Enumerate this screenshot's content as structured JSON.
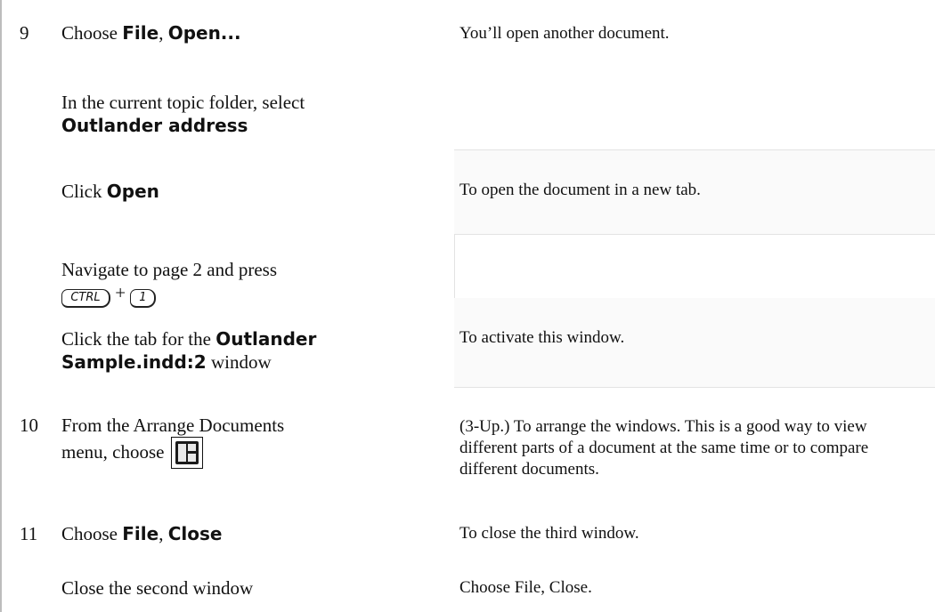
{
  "steps": [
    {
      "number": "9",
      "instruction": {
        "pre": "Choose ",
        "b1": "File",
        "mid": ", ",
        "b2": "Open..."
      },
      "result": "You’ll open another document."
    },
    {
      "instruction": {
        "pre": "In the current topic folder, select",
        "bold": "Outlander address"
      }
    },
    {
      "instruction": {
        "pre": "Click ",
        "bold": "Open"
      },
      "result": "To open the document in a new tab."
    },
    {
      "instruction": {
        "pre": "Navigate to page 2 and press",
        "key1": "CTRL",
        "plus": "+",
        "key2": "1"
      }
    },
    {
      "instruction": {
        "pre": "Click the tab for the ",
        "bold1": "Outlander",
        "bold2": "Sample.indd:2",
        "post": " window"
      },
      "result": "To activate this window."
    },
    {
      "number": "10",
      "instruction": {
        "line1": "From the Arrange Documents",
        "line2": "menu, choose",
        "icon": "three-up-layout-icon"
      },
      "result": "(3-Up.) To arrange the windows. This is a good way to view different parts of a document at the same time or to compare different documents."
    },
    {
      "number": "11",
      "instruction": {
        "pre": "Choose ",
        "b1": "File",
        "mid": ", ",
        "b2": "Close"
      },
      "result": "To close the third window."
    },
    {
      "instruction": {
        "text": "Close the second window"
      },
      "result": "Choose File, Close."
    }
  ]
}
